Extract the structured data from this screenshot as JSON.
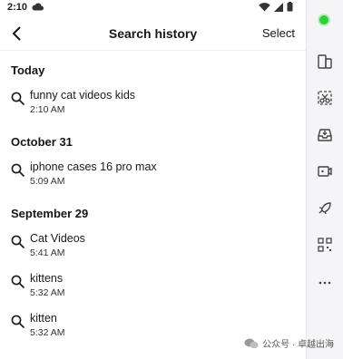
{
  "status_bar": {
    "time": "2:10"
  },
  "header": {
    "title": "Search history",
    "select_label": "Select"
  },
  "sections": [
    {
      "title": "Today",
      "items": [
        {
          "query": "funny cat videos kids",
          "time": "2:10 AM"
        }
      ]
    },
    {
      "title": "October 31",
      "items": [
        {
          "query": "iphone cases 16 pro max",
          "time": "5:09 AM"
        }
      ]
    },
    {
      "title": "September 29",
      "items": [
        {
          "query": "Cat Videos",
          "time": "5:41 AM"
        },
        {
          "query": "kittens",
          "time": "5:32 AM"
        },
        {
          "query": "kitten",
          "time": "5:32 AM"
        }
      ]
    }
  ],
  "toolbar": {
    "icons": [
      "status-dot",
      "phone-swap-icon",
      "scissors-icon",
      "inbox-icon",
      "video-icon",
      "rocket-icon",
      "qr-scan-icon",
      "more-icon"
    ],
    "status_color": "#2fce3a"
  },
  "watermark": {
    "text": "公众号 · 卓越出海"
  }
}
